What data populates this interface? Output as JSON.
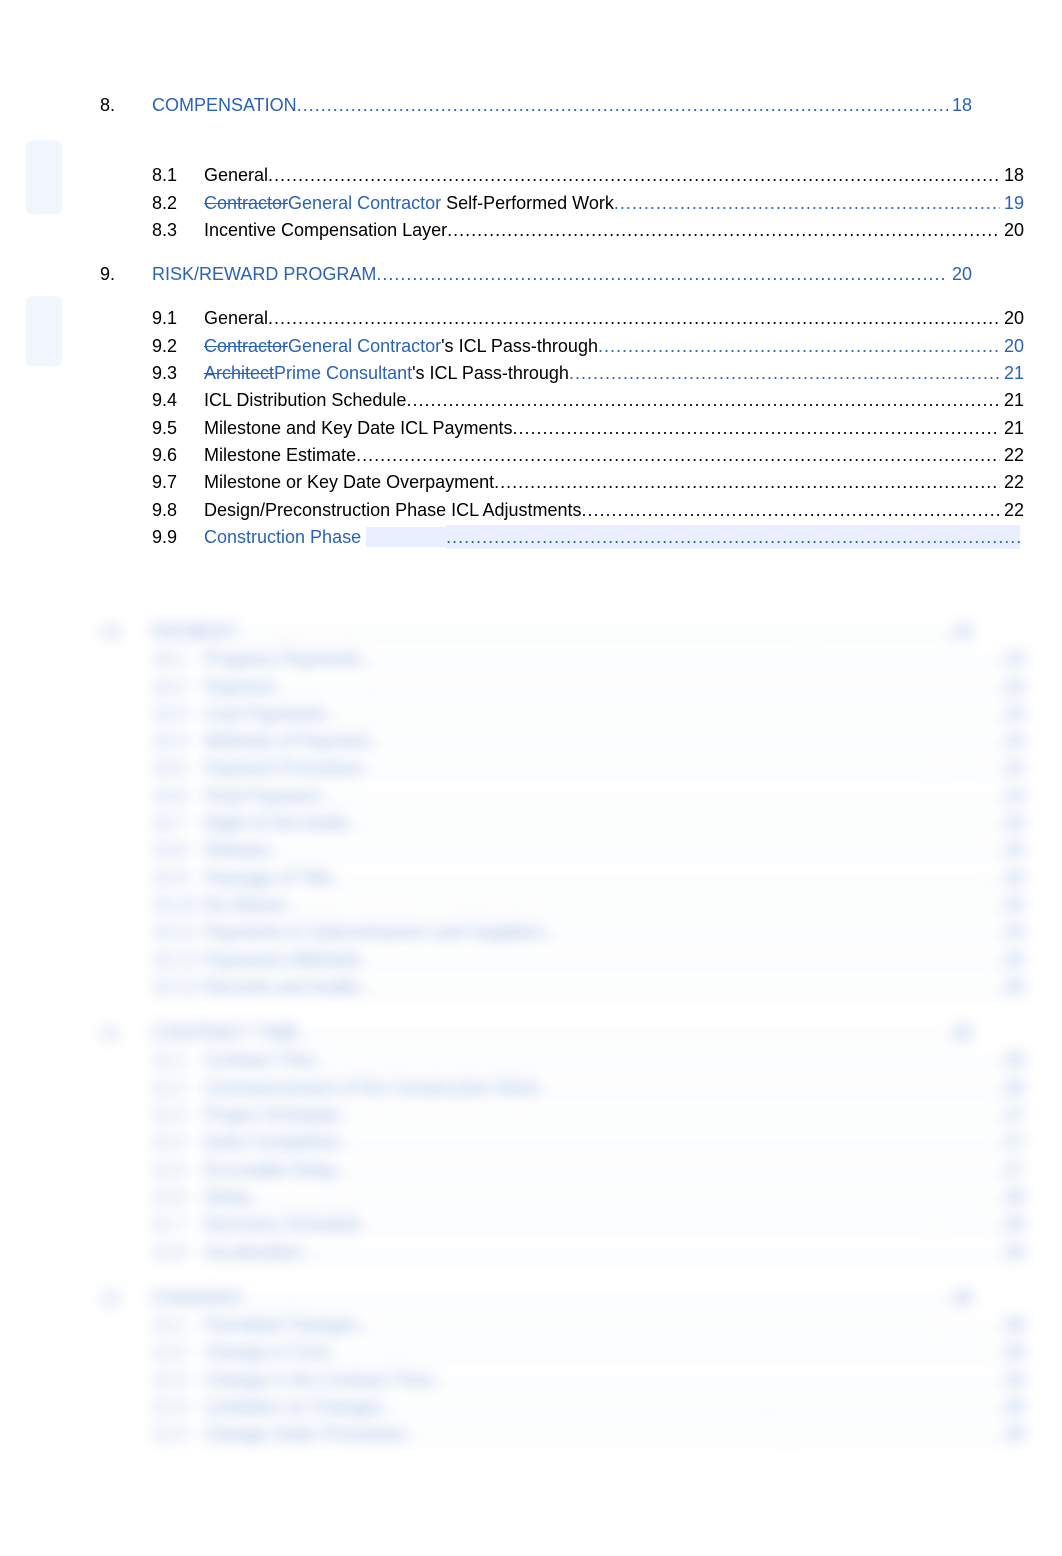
{
  "section8": {
    "num": "8.",
    "title": "COMPENSATION",
    "page": "18",
    "items": [
      {
        "num": "8.1",
        "label": "General",
        "page": "18",
        "style": "blk"
      },
      {
        "num": "8.2",
        "strike": "Contractor",
        "ins": "General Contractor",
        "rest": " Self-Performed Work",
        "page": "19",
        "style": "mix"
      },
      {
        "num": "8.3",
        "label": "Incentive Compensation Layer",
        "page": "20",
        "style": "blk"
      }
    ]
  },
  "section9": {
    "num": "9.",
    "title": "RISK/REWARD PROGRAM",
    "page": "20",
    "items": [
      {
        "num": "9.1",
        "label": "General",
        "page": "20",
        "style": "blk"
      },
      {
        "num": "9.2",
        "strike": "Contractor",
        "ins": "General Contractor",
        "rest": "'s ICL Pass-through",
        "page": "20",
        "style": "mix"
      },
      {
        "num": "9.3",
        "strike": "Architect",
        "ins": "Prime Consultant",
        "rest": "'s ICL Pass-through",
        "page": "21",
        "style": "mix"
      },
      {
        "num": "9.4",
        "label": "ICL Distribution Schedule",
        "page": "21",
        "style": "blk"
      },
      {
        "num": "9.5",
        "label": "Milestone and Key Date ICL Payments",
        "page": "21",
        "style": "blk"
      },
      {
        "num": "9.6",
        "label": "Milestone Estimate",
        "page": "22",
        "style": "blk"
      },
      {
        "num": "9.7",
        "label": "Milestone or Key Date Overpayment",
        "page": "22",
        "style": "blk"
      },
      {
        "num": "9.8",
        "label": "Design/Preconstruction Phase ICL Adjustments",
        "page": "22",
        "style": "blk"
      },
      {
        "num": "9.9",
        "label_lnk": "Construction Phase",
        "page": "",
        "style": "lnk-hl"
      }
    ]
  },
  "blurred": [
    {
      "type": "top",
      "num": "10.",
      "title": "PAYMENT",
      "page": "23"
    },
    {
      "type": "sub",
      "num": "10.1",
      "title": "Progress Payments",
      "page": "23"
    },
    {
      "type": "sub",
      "num": "10.2",
      "title": "Payment",
      "page": "23"
    },
    {
      "type": "sub",
      "num": "10.3",
      "title": "Cost Payments",
      "page": "23"
    },
    {
      "type": "sub",
      "num": "10.4",
      "title": "Methods of Payment",
      "page": "24"
    },
    {
      "type": "sub",
      "num": "10.5",
      "title": "Payment Procedure",
      "page": "24"
    },
    {
      "type": "sub",
      "num": "10.6",
      "title": "Final Payment",
      "page": "24"
    },
    {
      "type": "sub",
      "num": "10.7",
      "title": "Right of Set-Aside",
      "page": "25"
    },
    {
      "type": "sub",
      "num": "10.8",
      "title": "Release",
      "page": "25"
    },
    {
      "type": "sub",
      "num": "10.9",
      "title": "Passage of Title",
      "page": "25"
    },
    {
      "type": "sub",
      "num": "10.10",
      "title": "No Waiver",
      "page": "25"
    },
    {
      "type": "sub",
      "num": "10.11",
      "title": "Payments to Subcontractors and Suppliers",
      "page": "25"
    },
    {
      "type": "sub",
      "num": "10.12",
      "title": "Payments Withheld",
      "page": "25"
    },
    {
      "type": "sub",
      "num": "10.13",
      "title": "Records and Audits",
      "page": "26"
    },
    {
      "type": "top",
      "num": "11.",
      "title": "CONTRACT TIME",
      "page": "26"
    },
    {
      "type": "sub",
      "num": "11.1",
      "title": "Contract Time",
      "page": "26"
    },
    {
      "type": "sub",
      "num": "11.2",
      "title": "Commencement of the Construction Work",
      "page": "26"
    },
    {
      "type": "sub",
      "num": "11.3",
      "title": "Project Schedule",
      "page": "27"
    },
    {
      "type": "sub",
      "num": "11.4",
      "title": "Early Completion",
      "page": "27"
    },
    {
      "type": "sub",
      "num": "11.5",
      "title": "Excusable Delay",
      "page": "27"
    },
    {
      "type": "sub",
      "num": "11.6",
      "title": "Delay",
      "page": "28"
    },
    {
      "type": "sub",
      "num": "11.7",
      "title": "Recovery Schedule",
      "page": "28"
    },
    {
      "type": "sub",
      "num": "11.8",
      "title": "Acceleration",
      "page": "28"
    },
    {
      "type": "top",
      "num": "12.",
      "title": "CHANGES",
      "page": "28"
    },
    {
      "type": "sub",
      "num": "12.1",
      "title": "Permitted Changes",
      "page": "28"
    },
    {
      "type": "sub",
      "num": "12.2",
      "title": "Change in Cost",
      "page": "29"
    },
    {
      "type": "sub",
      "num": "12.3",
      "title": "Change in the Contract Time",
      "page": "29"
    },
    {
      "type": "sub",
      "num": "12.4",
      "title": "Limitation on Changes",
      "page": "29"
    },
    {
      "type": "sub",
      "num": "12.5",
      "title": "Change Order Procedure",
      "page": "29"
    }
  ]
}
